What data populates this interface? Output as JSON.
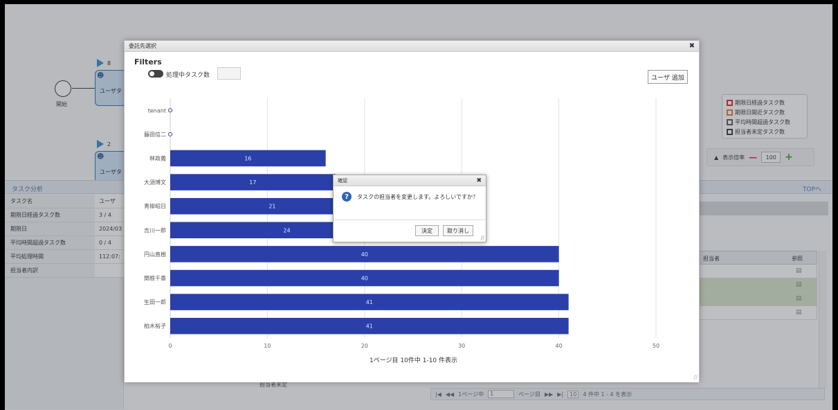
{
  "diagram": {
    "start_label": "開始",
    "task1": {
      "flag_count": "8",
      "label": "ユーザタ"
    },
    "task2": {
      "flag_count": "2",
      "label": "ユーザタ"
    }
  },
  "legend": {
    "items": [
      {
        "label": "期限日経過タスク数",
        "color": "#d9262b"
      },
      {
        "label": "期限日間近タスク数",
        "color": "#e07a2a"
      },
      {
        "label": "平均時間超過タスク数",
        "color": "#555555"
      },
      {
        "label": "担当者未定タスク数",
        "color": "#333333"
      }
    ]
  },
  "zoom": {
    "label": "表示倍率",
    "value": "100"
  },
  "analysis": {
    "title": "タスク分析",
    "top_link": "TOPへ"
  },
  "info_table": [
    {
      "label": "タスク名",
      "value": "ユーザ"
    },
    {
      "label": "期限日経過タスク数",
      "value": "3 / 4"
    },
    {
      "label": "期限日",
      "value": "2024/03"
    },
    {
      "label": "平均時間超過タスク数",
      "value": "0 / 4"
    },
    {
      "label": "平均処理時間",
      "value": "112:07:"
    },
    {
      "label": "担当者内訳",
      "value": ""
    }
  ],
  "right_table": {
    "col1": "担当者",
    "col2": "参照"
  },
  "pager": {
    "prefix": "1ページ中",
    "page": "1",
    "suffix": "ページ目",
    "per_page": "10",
    "summary": "4 件中 1 - 4 を表示"
  },
  "legend_bottom": "担当者未定",
  "dialog": {
    "title": "委託先選択",
    "filters_title": "Filters",
    "toggle_label": "処理中タスク数",
    "add_user_label": "ユーザ 追加",
    "page_info": "1ページ目 10件中 1-10 件表示"
  },
  "chart_data": {
    "type": "bar",
    "orientation": "horizontal",
    "categories": [
      "tenant",
      "藤田信二",
      "林政義",
      "大須博文",
      "青柳昭日",
      "吉川一郎",
      "円山直樹",
      "関根千香",
      "生田一郎",
      "柏木裕子"
    ],
    "values": [
      0,
      0,
      16,
      17,
      21,
      24,
      40,
      40,
      41,
      41
    ],
    "xlim": [
      0,
      50
    ],
    "xticks": [
      0,
      10,
      20,
      30,
      40,
      50
    ],
    "bar_color": "#2a3fa8",
    "grid": true
  },
  "confirm": {
    "title": "確認",
    "message": "タスクの担当者を変更します。よろしいですか？",
    "ok_label": "決定",
    "cancel_label": "取り消し"
  }
}
